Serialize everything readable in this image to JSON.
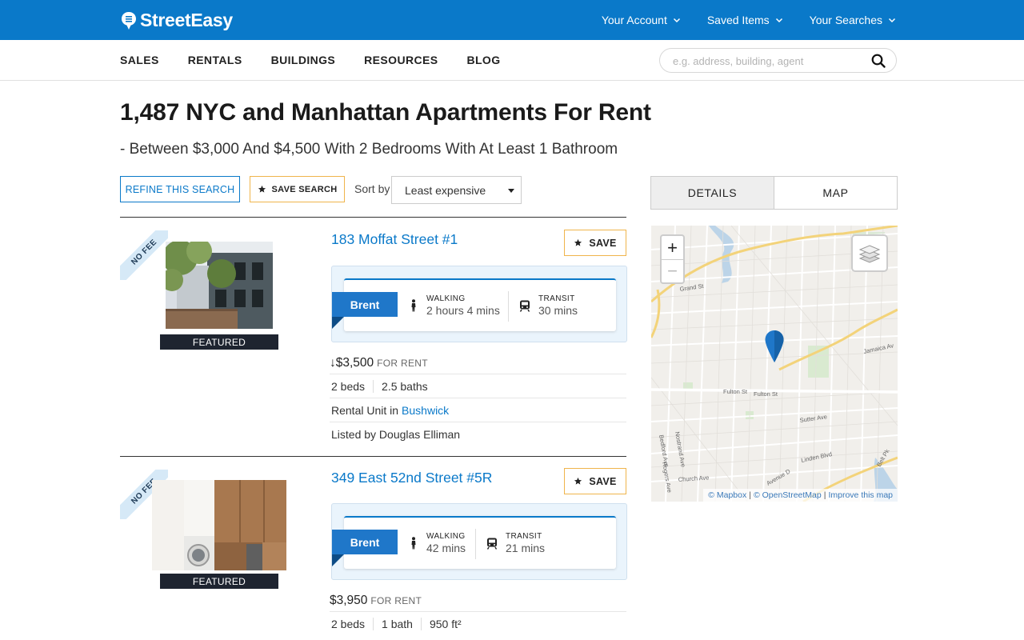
{
  "header": {
    "logo_text": "StreetEasy",
    "nav": [
      {
        "label": "Your Account"
      },
      {
        "label": "Saved Items"
      },
      {
        "label": "Your Searches"
      }
    ],
    "brand_color": "#0a79c9"
  },
  "secondary_nav": {
    "items": [
      {
        "label": "SALES"
      },
      {
        "label": "RENTALS"
      },
      {
        "label": "BUILDINGS"
      },
      {
        "label": "RESOURCES"
      },
      {
        "label": "BLOG"
      }
    ],
    "search_placeholder": "e.g. address, building, agent"
  },
  "page": {
    "title": "1,487 NYC and Manhattan Apartments For Rent",
    "subtitle": "- Between $3,000 And $4,500 With 2 Bedrooms With At Least 1 Bathroom"
  },
  "controls": {
    "refine_label": "REFINE THIS SEARCH",
    "save_search_label": "SAVE SEARCH",
    "sort_label": "Sort by",
    "sort_value": "Least expensive"
  },
  "listings": [
    {
      "badge": "NO FEE",
      "featured_label": "FEATURED",
      "address": "183 Moffat Street #1",
      "save_label": "SAVE",
      "commute": {
        "name": "Brent",
        "walking_label": "WALKING",
        "walking_time": "2 hours 4 mins",
        "transit_label": "TRANSIT",
        "transit_time": "30 mins"
      },
      "price_arrow": "↓",
      "price": "$3,500",
      "price_suffix": "FOR RENT",
      "beds": "2 beds",
      "baths": "2.5 baths",
      "type_prefix": "Rental Unit in",
      "neighborhood": "Bushwick",
      "listed_by": "Listed by Douglas Elliman"
    },
    {
      "badge": "NO FEE",
      "featured_label": "FEATURED",
      "address": "349 East 52nd Street #5R",
      "save_label": "SAVE",
      "commute": {
        "name": "Brent",
        "walking_label": "WALKING",
        "walking_time": "42 mins",
        "transit_label": "TRANSIT",
        "transit_time": "21 mins"
      },
      "price": "$3,950",
      "price_suffix": "FOR RENT",
      "beds": "2 beds",
      "baths": "1 bath",
      "area": "950 ft²"
    }
  ],
  "right_panel": {
    "tabs": [
      {
        "label": "DETAILS",
        "active": true
      },
      {
        "label": "MAP",
        "active": false
      }
    ],
    "map": {
      "zoom_in": "+",
      "zoom_out": "−",
      "street_labels": [
        "Grand St",
        "Jamaica Ave",
        "Fulton St",
        "Fulton St",
        "Sutter Ave",
        "Bedford Ave",
        "Nostrand Ave",
        "Rogers Ave",
        "Linden Blvd",
        "Church Ave",
        "Avenue D",
        "Belt Pkwy"
      ],
      "attribution": {
        "mapbox": "© Mapbox",
        "osm": "© OpenStreetMap",
        "improve": "Improve this map",
        "sep": "|"
      },
      "pin_color": "#1f77c9"
    }
  }
}
